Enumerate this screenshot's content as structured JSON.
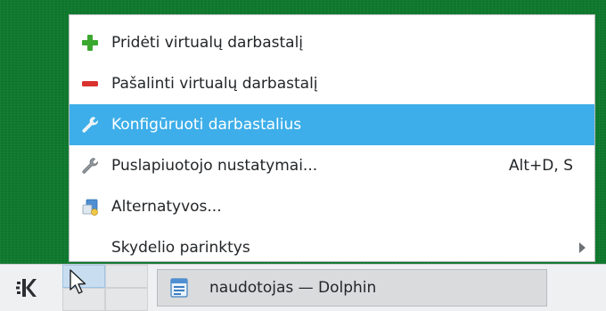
{
  "menu": {
    "items": [
      {
        "label": "Pridėti virtualų darbastalį",
        "icon": "add-plus-icon",
        "shortcut": "",
        "highlighted": false,
        "submenu": false
      },
      {
        "label": "Pašalinti virtualų darbastalį",
        "icon": "remove-minus-icon",
        "shortcut": "",
        "highlighted": false,
        "submenu": false
      },
      {
        "label": "Konfigūruoti darbastalius",
        "icon": "wrench-icon",
        "shortcut": "",
        "highlighted": true,
        "submenu": false
      },
      {
        "label": "Puslapiuotojo nustatymai...",
        "icon": "wrench-icon",
        "shortcut": "Alt+D, S",
        "highlighted": false,
        "submenu": false
      },
      {
        "label": "Alternatyvos...",
        "icon": "alternatives-icon",
        "shortcut": "",
        "highlighted": false,
        "submenu": false
      },
      {
        "label": "Skydelio parinktys",
        "icon": "",
        "shortcut": "",
        "highlighted": false,
        "submenu": true
      }
    ]
  },
  "panel": {
    "launcher_icon": "kde-logo-icon",
    "pager": {
      "desktops": 4,
      "active_desktop": 1
    },
    "task": {
      "label": "naudotojas — Dolphin",
      "icon": "dolphin-file-manager-icon"
    }
  },
  "colors": {
    "highlight": "#3daee9",
    "desktop_green": "#0f7a2e",
    "panel_bg": "#eff0f1",
    "add_green": "#3aa82e",
    "remove_red": "#d9322f"
  }
}
